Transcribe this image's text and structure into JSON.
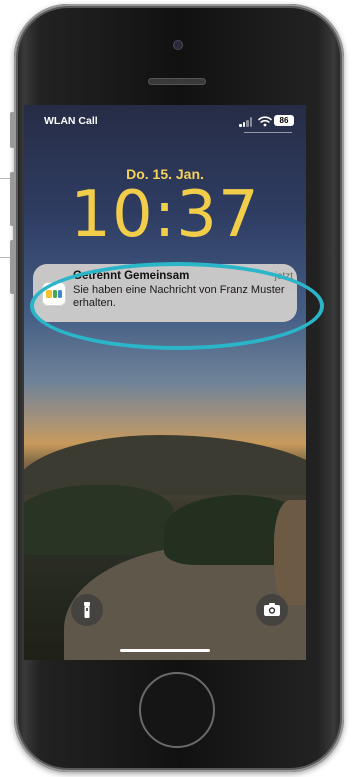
{
  "status_bar": {
    "carrier": "WLAN Call",
    "battery": "86"
  },
  "lock_screen": {
    "date": "Do. 15. Jan.",
    "time": "10:37"
  },
  "notification": {
    "app_name": "Getrennt Gemeinsam",
    "time": "jetzt",
    "message": "Sie haben eine Nachricht von Franz Muster erhalten."
  },
  "icons": {
    "flashlight": "flashlight-icon",
    "camera": "camera-icon",
    "signal": "signal-icon",
    "wifi": "wifi-icon"
  },
  "colors": {
    "clock": "#f2cd4a",
    "highlight": "#2bb5c9"
  }
}
